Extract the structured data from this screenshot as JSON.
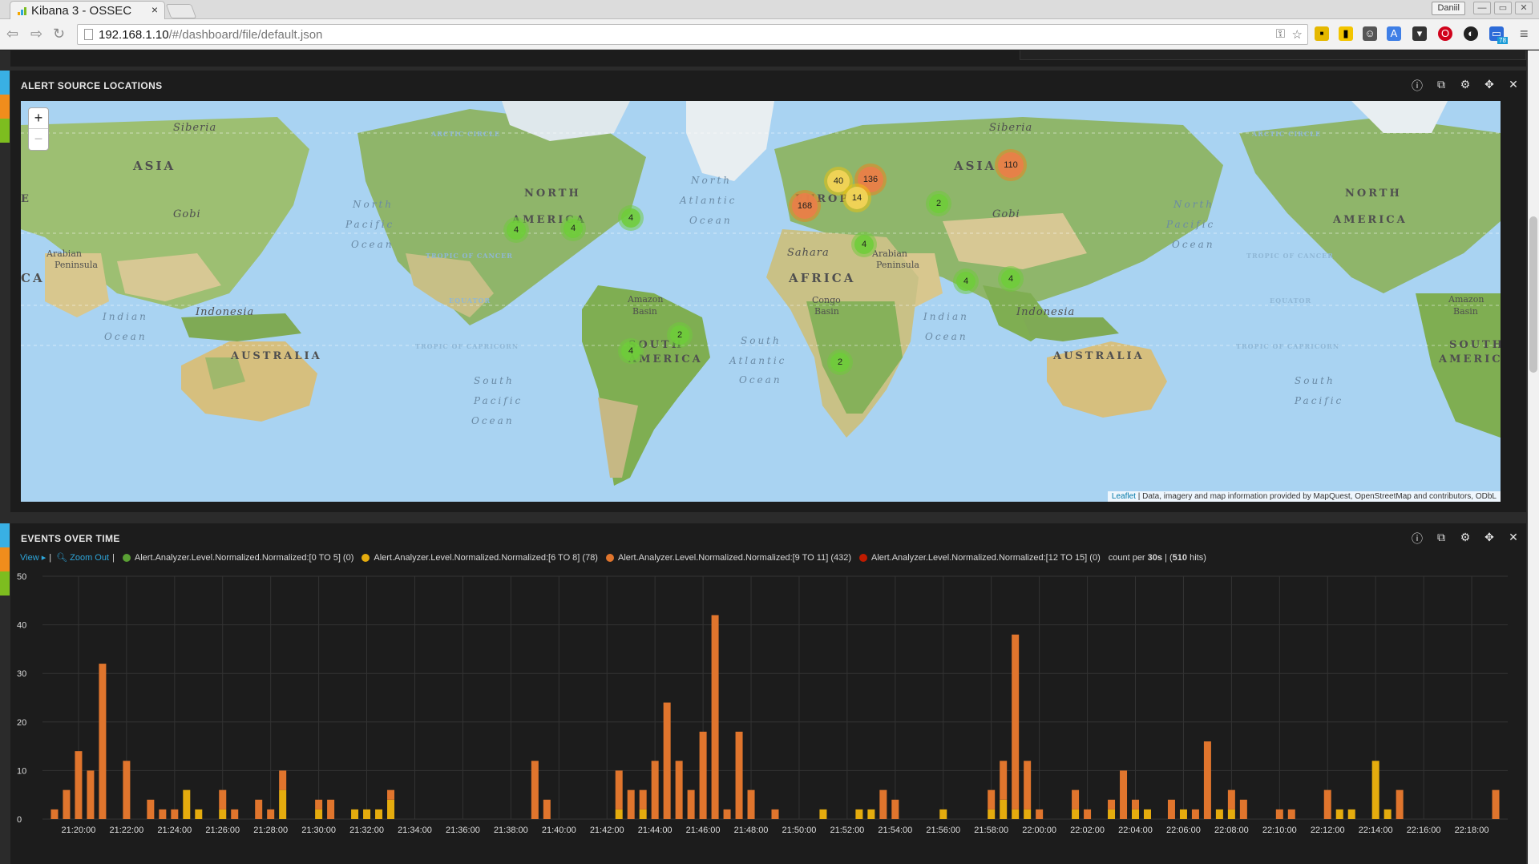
{
  "browser": {
    "tab_title": "Kibana 3 - OSSEC",
    "tab_close": "×",
    "user_badge": "Daniil",
    "window_controls": [
      "—",
      "▭",
      "✕"
    ],
    "url_host": "192.168.1.10",
    "url_path": "/#/dashboard/file/default.json",
    "extension_icons": [
      "imdb-extension-icon",
      "tag-extension-icon",
      "people-extension-icon",
      "translate-extension-icon",
      "pocket-extension-icon",
      "opera-extension-icon",
      "dark-reader-icon",
      "screen-extension-icon"
    ],
    "extension_badge": "78"
  },
  "map_panel": {
    "title": "ALERT SOURCE LOCATIONS",
    "zoom_in": "+",
    "zoom_out": "−",
    "attribution_link": "Leaflet",
    "attribution_text": " | Data, imagery and map information provided by MapQuest, OpenStreetMap and contributors, ODbL",
    "labels": {
      "siberia_w": "Siberia",
      "asia_w": "ASIA",
      "gobi_w": "Gobi",
      "arabian_w": "Arabian",
      "peninsula_w": "Peninsula",
      "indian_w": "Indian",
      "ocean_indian_w": "Ocean",
      "indonesia_w": "Indonesia",
      "australia_w": "AUSTRALIA",
      "arctic_w": "ARCTIC CIRCLE",
      "north_pac": "North",
      "pacific": "Pacific",
      "ocean_pac": "Ocean",
      "tropic_cancer_w": "TROPIC OF CANCER",
      "equator_w": "EQUATOR",
      "tropic_cap_w": "TROPIC OF CAPRICORN",
      "south_pac": "South",
      "pacific_s": "Pacific",
      "ocean_ps": "Ocean",
      "north_am": "NORTH",
      "america_n": "AMERICA",
      "north_atl": "North",
      "atlantic": "Atlantic",
      "ocean_atl": "Ocean",
      "europe": "EUROPE",
      "sahara": "Sahara",
      "africa": "AFRICA",
      "congo": "Congo",
      "basin_c": "Basin",
      "amazon": "Amazon",
      "basin_a": "Basin",
      "south_am": "SOUTH",
      "america_s": "AMERICA",
      "south_atl": "South",
      "atlantic_s": "Atlantic",
      "ocean_as": "Ocean",
      "siberia_e": "Siberia",
      "asia_e": "ASIA",
      "gobi_e": "Gobi",
      "arabian_e": "Arabian",
      "peninsula_e": "Peninsula",
      "indian_e": "Indian",
      "ocean_indian_e": "Ocean",
      "indonesia_e": "Indonesia",
      "australia_e": "AUSTRALIA",
      "arctic_e": "ARCTIC CIRCLE",
      "north_pac_e": "North",
      "pacific_e": "Pacific",
      "ocean_pac_e": "Ocean",
      "tropic_cancer_e": "TROPIC OF CANCER",
      "equator_e": "EQUATOR",
      "tropic_cap_e": "TROPIC OF CAPRICORN",
      "north_am_e": "NORTH",
      "america_ne": "AMERICA",
      "amazon_e": "Amazon",
      "basin_ae": "Basin",
      "south_am_e": "SOUTH",
      "america_se": "AMERICA",
      "south_pac_e": "South",
      "pacific_se": "Pacific",
      "edge_e": "E",
      "edge_ca": "CA"
    },
    "clusters": [
      {
        "count": "4",
        "level": "green"
      },
      {
        "count": "4",
        "level": "green"
      },
      {
        "count": "4",
        "level": "green"
      },
      {
        "count": "40",
        "level": "yellow"
      },
      {
        "count": "136",
        "level": "orange"
      },
      {
        "count": "14",
        "level": "yellow"
      },
      {
        "count": "168",
        "level": "orange"
      },
      {
        "count": "110",
        "level": "orange"
      },
      {
        "count": "2",
        "level": "green"
      },
      {
        "count": "4",
        "level": "green"
      },
      {
        "count": "4",
        "level": "green"
      },
      {
        "count": "4",
        "level": "green"
      },
      {
        "count": "2",
        "level": "green"
      },
      {
        "count": "4",
        "level": "green"
      },
      {
        "count": "2",
        "level": "green"
      }
    ]
  },
  "events_panel": {
    "title": "EVENTS OVER TIME",
    "view_label": "View ▸",
    "separator": "|",
    "zoom_out_label": "Zoom Out",
    "legend": [
      {
        "label": "Alert.Analyzer.Level.Normalized.Normalized:[0 TO 5] (0)",
        "color": "#5aa034"
      },
      {
        "label": "Alert.Analyzer.Level.Normalized.Normalized:[6 TO 8] (78)",
        "color": "#e5ac0e"
      },
      {
        "label": "Alert.Analyzer.Level.Normalized.Normalized:[9 TO 11] (432)",
        "color": "#e0752d"
      },
      {
        "label": "Alert.Analyzer.Level.Normalized.Normalized:[12 TO 15] (0)",
        "color": "#bf1b00"
      }
    ],
    "count_prefix": "count per ",
    "interval": "30s",
    "hits_prefix": " | (",
    "hits": "510",
    "hits_suffix": " hits)"
  },
  "chart_data": {
    "type": "bar",
    "stacked": true,
    "title": "EVENTS OVER TIME",
    "ylim": [
      0,
      50
    ],
    "yticks": [
      0,
      10,
      20,
      30,
      40,
      50
    ],
    "grid": true,
    "x_tick_labels": [
      "21:20:00",
      "21:22:00",
      "21:24:00",
      "21:26:00",
      "21:28:00",
      "21:30:00",
      "21:32:00",
      "21:34:00",
      "21:36:00",
      "21:38:00",
      "21:40:00",
      "21:42:00",
      "21:44:00",
      "21:46:00",
      "21:48:00",
      "21:50:00",
      "21:52:00",
      "21:54:00",
      "21:56:00",
      "21:58:00",
      "22:00:00",
      "22:02:00",
      "22:04:00",
      "22:06:00",
      "22:08:00",
      "22:10:00",
      "22:12:00",
      "22:14:00",
      "22:16:00",
      "22:18:00"
    ],
    "series_colors": {
      "level_6_8": "#e5ac0e",
      "level_9_11": "#e0752d"
    },
    "bars": [
      {
        "t": "21:19:00",
        "level_6_8": 0,
        "level_9_11": 2
      },
      {
        "t": "21:19:30",
        "level_6_8": 0,
        "level_9_11": 6
      },
      {
        "t": "21:20:00",
        "level_6_8": 0,
        "level_9_11": 14
      },
      {
        "t": "21:20:30",
        "level_6_8": 0,
        "level_9_11": 10
      },
      {
        "t": "21:21:00",
        "level_6_8": 0,
        "level_9_11": 32
      },
      {
        "t": "21:22:00",
        "level_6_8": 0,
        "level_9_11": 12
      },
      {
        "t": "21:23:00",
        "level_6_8": 0,
        "level_9_11": 4
      },
      {
        "t": "21:23:30",
        "level_6_8": 0,
        "level_9_11": 2
      },
      {
        "t": "21:24:00",
        "level_6_8": 0,
        "level_9_11": 2
      },
      {
        "t": "21:24:30",
        "level_6_8": 6,
        "level_9_11": 0
      },
      {
        "t": "21:25:00",
        "level_6_8": 2,
        "level_9_11": 0
      },
      {
        "t": "21:26:00",
        "level_6_8": 2,
        "level_9_11": 4
      },
      {
        "t": "21:26:30",
        "level_6_8": 0,
        "level_9_11": 2
      },
      {
        "t": "21:27:30",
        "level_6_8": 0,
        "level_9_11": 4
      },
      {
        "t": "21:28:00",
        "level_6_8": 0,
        "level_9_11": 2
      },
      {
        "t": "21:28:30",
        "level_6_8": 6,
        "level_9_11": 4
      },
      {
        "t": "21:30:00",
        "level_6_8": 2,
        "level_9_11": 2
      },
      {
        "t": "21:30:30",
        "level_6_8": 0,
        "level_9_11": 4
      },
      {
        "t": "21:31:30",
        "level_6_8": 2,
        "level_9_11": 0
      },
      {
        "t": "21:32:00",
        "level_6_8": 2,
        "level_9_11": 0
      },
      {
        "t": "21:32:30",
        "level_6_8": 2,
        "level_9_11": 0
      },
      {
        "t": "21:33:00",
        "level_6_8": 4,
        "level_9_11": 2
      },
      {
        "t": "21:39:00",
        "level_6_8": 0,
        "level_9_11": 12
      },
      {
        "t": "21:39:30",
        "level_6_8": 0,
        "level_9_11": 4
      },
      {
        "t": "21:42:30",
        "level_6_8": 2,
        "level_9_11": 8
      },
      {
        "t": "21:43:00",
        "level_6_8": 0,
        "level_9_11": 6
      },
      {
        "t": "21:43:30",
        "level_6_8": 2,
        "level_9_11": 4
      },
      {
        "t": "21:44:00",
        "level_6_8": 0,
        "level_9_11": 12
      },
      {
        "t": "21:44:30",
        "level_6_8": 0,
        "level_9_11": 24
      },
      {
        "t": "21:45:00",
        "level_6_8": 0,
        "level_9_11": 12
      },
      {
        "t": "21:45:30",
        "level_6_8": 0,
        "level_9_11": 6
      },
      {
        "t": "21:46:00",
        "level_6_8": 0,
        "level_9_11": 18
      },
      {
        "t": "21:46:30",
        "level_6_8": 0,
        "level_9_11": 42
      },
      {
        "t": "21:47:00",
        "level_6_8": 0,
        "level_9_11": 2
      },
      {
        "t": "21:47:30",
        "level_6_8": 0,
        "level_9_11": 18
      },
      {
        "t": "21:48:00",
        "level_6_8": 0,
        "level_9_11": 6
      },
      {
        "t": "21:49:00",
        "level_6_8": 0,
        "level_9_11": 2
      },
      {
        "t": "21:51:00",
        "level_6_8": 2,
        "level_9_11": 0
      },
      {
        "t": "21:52:30",
        "level_6_8": 2,
        "level_9_11": 0
      },
      {
        "t": "21:53:00",
        "level_6_8": 2,
        "level_9_11": 0
      },
      {
        "t": "21:53:30",
        "level_6_8": 0,
        "level_9_11": 6
      },
      {
        "t": "21:54:00",
        "level_6_8": 0,
        "level_9_11": 4
      },
      {
        "t": "21:56:00",
        "level_6_8": 2,
        "level_9_11": 0
      },
      {
        "t": "21:58:00",
        "level_6_8": 2,
        "level_9_11": 4
      },
      {
        "t": "21:58:30",
        "level_6_8": 4,
        "level_9_11": 8
      },
      {
        "t": "21:59:00",
        "level_6_8": 2,
        "level_9_11": 36
      },
      {
        "t": "21:59:30",
        "level_6_8": 2,
        "level_9_11": 10
      },
      {
        "t": "22:00:00",
        "level_6_8": 0,
        "level_9_11": 2
      },
      {
        "t": "22:01:30",
        "level_6_8": 2,
        "level_9_11": 4
      },
      {
        "t": "22:02:00",
        "level_6_8": 0,
        "level_9_11": 2
      },
      {
        "t": "22:03:00",
        "level_6_8": 2,
        "level_9_11": 2
      },
      {
        "t": "22:03:30",
        "level_6_8": 0,
        "level_9_11": 10
      },
      {
        "t": "22:04:00",
        "level_6_8": 2,
        "level_9_11": 2
      },
      {
        "t": "22:04:30",
        "level_6_8": 2,
        "level_9_11": 0
      },
      {
        "t": "22:05:30",
        "level_6_8": 0,
        "level_9_11": 4
      },
      {
        "t": "22:06:00",
        "level_6_8": 2,
        "level_9_11": 0
      },
      {
        "t": "22:06:30",
        "level_6_8": 0,
        "level_9_11": 2
      },
      {
        "t": "22:07:00",
        "level_6_8": 0,
        "level_9_11": 16
      },
      {
        "t": "22:07:30",
        "level_6_8": 2,
        "level_9_11": 0
      },
      {
        "t": "22:08:00",
        "level_6_8": 2,
        "level_9_11": 4
      },
      {
        "t": "22:08:30",
        "level_6_8": 0,
        "level_9_11": 4
      },
      {
        "t": "22:10:00",
        "level_6_8": 0,
        "level_9_11": 2
      },
      {
        "t": "22:10:30",
        "level_6_8": 0,
        "level_9_11": 2
      },
      {
        "t": "22:12:00",
        "level_6_8": 0,
        "level_9_11": 6
      },
      {
        "t": "22:12:30",
        "level_6_8": 2,
        "level_9_11": 0
      },
      {
        "t": "22:13:00",
        "level_6_8": 2,
        "level_9_11": 0
      },
      {
        "t": "22:14:00",
        "level_6_8": 12,
        "level_9_11": 0
      },
      {
        "t": "22:14:30",
        "level_6_8": 2,
        "level_9_11": 0
      },
      {
        "t": "22:15:00",
        "level_6_8": 0,
        "level_9_11": 6
      },
      {
        "t": "22:19:00",
        "level_6_8": 0,
        "level_9_11": 6
      }
    ]
  }
}
